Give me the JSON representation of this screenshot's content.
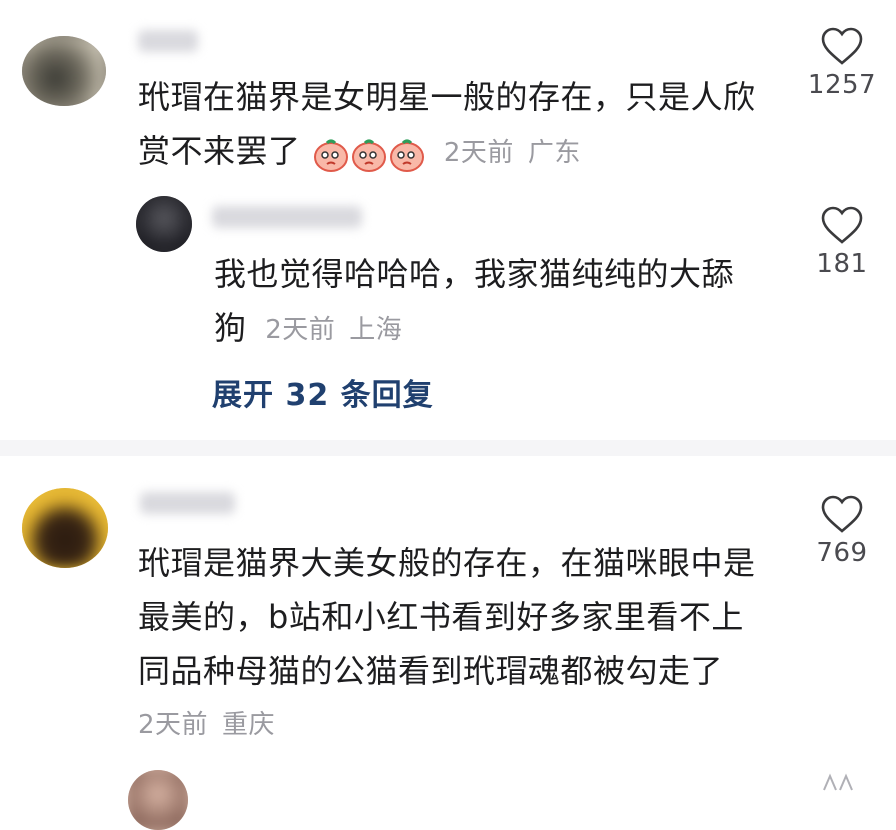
{
  "comments": [
    {
      "text_line1": "玳瑁在猫界是女明星一般的存在，只是人欣",
      "text_line2": "赏不来罢了",
      "emoji_icons": [
        "blushing-face-icon",
        "blushing-face-icon",
        "blushing-face-icon"
      ],
      "time": "2天前",
      "location": "广东",
      "likes": "1257"
    },
    {
      "text_line1": "我也觉得哈哈哈，我家猫纯纯的大舔",
      "text_line2": "狗",
      "time": "2天前",
      "location": "上海",
      "likes": "181",
      "is_reply": true
    },
    {
      "text_line1": "玳瑁是猫界大美女般的存在，在猫咪眼中是",
      "text_line2": "最美的，b站和小红书看到好多家里看不上",
      "text_line3": "同品种母猫的公猫看到玳瑁魂都被勾走了",
      "time": "2天前",
      "location": "重庆",
      "likes": "769"
    }
  ],
  "expand_replies": "展开 32 条回复",
  "colors": {
    "text": "#1d1d1f",
    "meta": "#9a9aa0",
    "link": "#20406f",
    "heart": "#3a3a3c"
  }
}
